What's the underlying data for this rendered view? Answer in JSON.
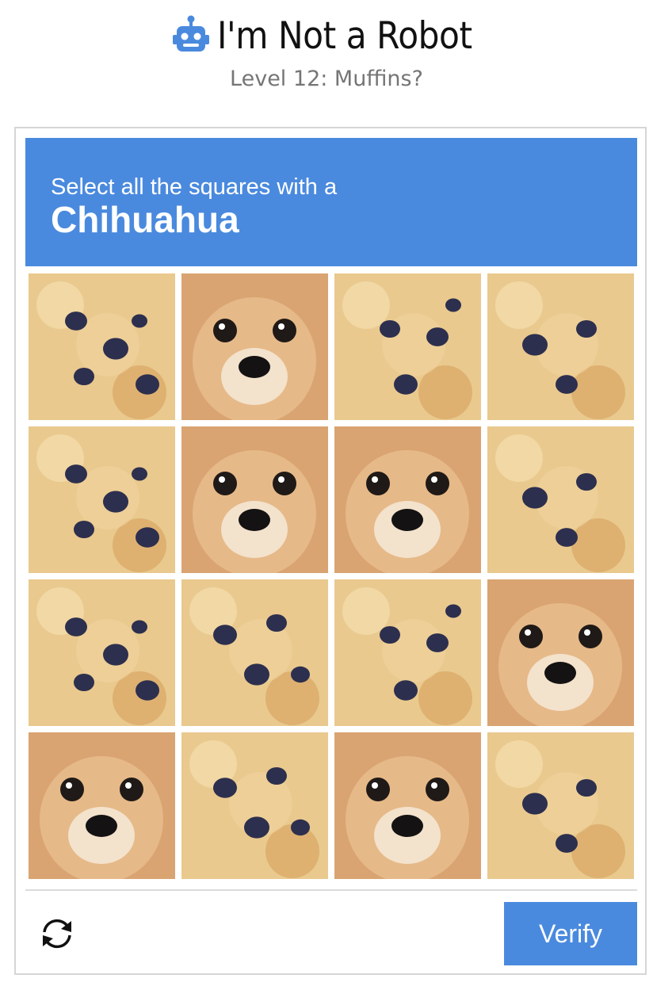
{
  "header": {
    "title": "I'm Not a Robot",
    "subtitle": "Level 12: Muffins?",
    "icon": "robot-icon"
  },
  "captcha": {
    "instruction": "Select all the squares with a",
    "target": "Chihuahua",
    "verify_label": "Verify",
    "reload_icon": "reload-icon",
    "banner_color": "#4a8ade",
    "tiles": [
      {
        "kind": "muffin"
      },
      {
        "kind": "chihuahua"
      },
      {
        "kind": "muffin"
      },
      {
        "kind": "muffin"
      },
      {
        "kind": "muffin"
      },
      {
        "kind": "chihuahua"
      },
      {
        "kind": "chihuahua"
      },
      {
        "kind": "muffin"
      },
      {
        "kind": "muffin"
      },
      {
        "kind": "muffin"
      },
      {
        "kind": "muffin"
      },
      {
        "kind": "chihuahua"
      },
      {
        "kind": "chihuahua"
      },
      {
        "kind": "muffin"
      },
      {
        "kind": "chihuahua"
      },
      {
        "kind": "muffin"
      }
    ]
  }
}
